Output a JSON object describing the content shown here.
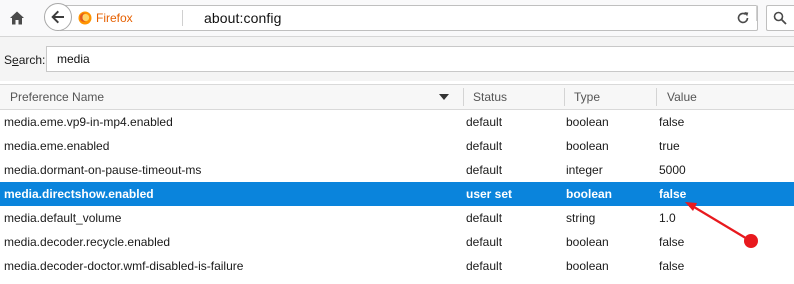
{
  "toolbar": {
    "browser_identity": "Firefox",
    "url": "about:config"
  },
  "search": {
    "label_prefix": "S",
    "label_underlined": "e",
    "label_suffix": "arch:",
    "value": "media"
  },
  "table": {
    "columns": [
      "Preference Name",
      "Status",
      "Type",
      "Value"
    ],
    "rows": [
      {
        "name": "media.eme.vp9-in-mp4.enabled",
        "status": "default",
        "type": "boolean",
        "value": "false"
      },
      {
        "name": "media.eme.enabled",
        "status": "default",
        "type": "boolean",
        "value": "true"
      },
      {
        "name": "media.dormant-on-pause-timeout-ms",
        "status": "default",
        "type": "integer",
        "value": "5000"
      },
      {
        "name": "media.directshow.enabled",
        "status": "user set",
        "type": "boolean",
        "value": "false"
      },
      {
        "name": "media.default_volume",
        "status": "default",
        "type": "string",
        "value": "1.0"
      },
      {
        "name": "media.decoder.recycle.enabled",
        "status": "default",
        "type": "boolean",
        "value": "false"
      },
      {
        "name": "media.decoder-doctor.wmf-disabled-is-failure",
        "status": "default",
        "type": "boolean",
        "value": "false"
      }
    ],
    "selected_row": "media.directshow.enabled"
  },
  "colors": {
    "selection": "#0a84dc",
    "annotation_arrow": "#e8191e",
    "firefox_brand": "#e66000"
  },
  "icons": [
    "home-icon",
    "back-arrow-icon",
    "firefox-logo-icon",
    "dropdown-arrow-icon",
    "reload-icon",
    "search-icon",
    "sort-descending-icon"
  ]
}
